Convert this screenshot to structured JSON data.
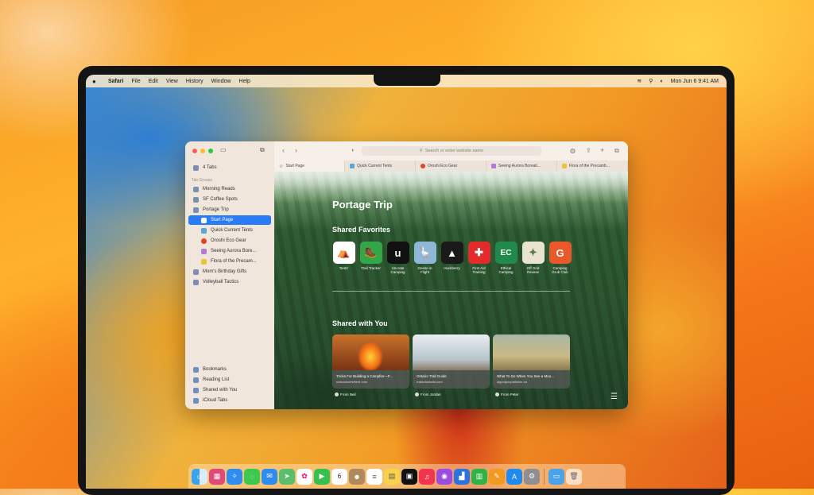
{
  "menubar": {
    "apple": "",
    "items": [
      "Safari",
      "File",
      "Edit",
      "View",
      "History",
      "Window",
      "Help"
    ],
    "datetime": "Mon Jun 6  9:41 AM"
  },
  "sidebar": {
    "tabs_count": "4 Tabs",
    "section_label": "Tab Groups",
    "items": [
      {
        "label": "Morning Reads"
      },
      {
        "label": "SF Coffee Spots"
      },
      {
        "label": "Portage Trip"
      },
      {
        "label": "Start Page"
      },
      {
        "label": "Quick Current Tents"
      },
      {
        "label": "Oroshi Eco Gear"
      },
      {
        "label": "Seeing Aurora Bore..."
      },
      {
        "label": "Flora of the Precam..."
      },
      {
        "label": "Mom's Birthday Gifts"
      },
      {
        "label": "Volleyball Tactics"
      }
    ],
    "bottom": [
      {
        "label": "Bookmarks"
      },
      {
        "label": "Reading List"
      },
      {
        "label": "Shared with You"
      },
      {
        "label": "iCloud Tabs"
      }
    ]
  },
  "toolbar": {
    "placeholder": "Search or enter website name"
  },
  "tabs": [
    {
      "label": "Start Page"
    },
    {
      "label": "Quick Current Tents"
    },
    {
      "label": "Oroshi Eco Gear"
    },
    {
      "label": "Seeing Aurora Boreali..."
    },
    {
      "label": "Flora of the Precamb..."
    }
  ],
  "page": {
    "title": "Portage Trip",
    "favorites_heading": "Shared Favorites",
    "favorites": [
      {
        "label": "Tentrr",
        "glyph": "⛺",
        "color": "#ffffff"
      },
      {
        "label": "Trail Tracker",
        "glyph": "🥾",
        "color": "#33a64a"
      },
      {
        "label": "Uncrate Camping",
        "glyph": "u",
        "color": "#111111"
      },
      {
        "label": "Geese in Flight",
        "glyph": "🪿",
        "color": "#8fb7d8"
      },
      {
        "label": "Huckberry",
        "glyph": "▲",
        "color": "#1a1a1a"
      },
      {
        "label": "First Aid Training",
        "glyph": "✚",
        "color": "#e32b2b"
      },
      {
        "label": "Ethical Camping",
        "glyph": "EC",
        "color": "#1f8a4b"
      },
      {
        "label": "Off Grid Review",
        "glyph": "✦",
        "color": "#e9e4d0"
      },
      {
        "label": "Camping Grub Club",
        "glyph": "G",
        "color": "#e8582a"
      }
    ],
    "shared_heading": "Shared with You",
    "cards": [
      {
        "title": "Tricks For Building a Campfire—F...",
        "site": "notsosomewhere.com",
        "from": "From Neil"
      },
      {
        "title": "Ontario Trail Guide",
        "site": "trailsofontario.com",
        "from": "From Jordan"
      },
      {
        "title": "What To Do When You See a Moo...",
        "site": "algonquinparkhike.ca",
        "from": "From Peter"
      }
    ]
  },
  "dock": {
    "calendar_day": "6"
  }
}
